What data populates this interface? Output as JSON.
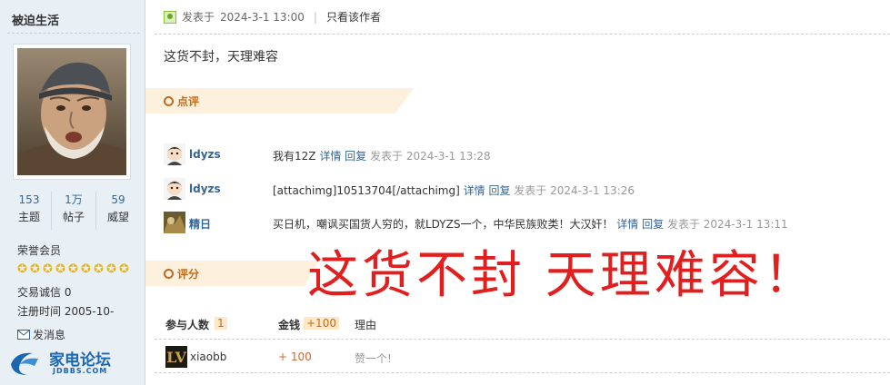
{
  "author": {
    "name": "被迫生活",
    "stats": [
      {
        "value": "153",
        "label": "主题"
      },
      {
        "value": "1万",
        "label": "帖子"
      },
      {
        "value": "59",
        "label": "威望"
      }
    ],
    "rank": "荣誉会员",
    "star_count": 9,
    "trade_label": "交易诚信",
    "trade_value": "0",
    "reg_label": "注册时间",
    "reg_value": "2005-10-",
    "pm_label": "发消息"
  },
  "forum_logo": {
    "name": "家电论坛",
    "domain": "JDBBS.COM"
  },
  "post": {
    "posted_label": "发表于",
    "posted_time": "2024-3-1 13:00",
    "separator": "|",
    "only_author": "只看该作者",
    "content": "这货不封，天理难容",
    "overlay_text": "这货不封  天理难容！"
  },
  "comments_section": {
    "title": "点评",
    "items": [
      {
        "user": "ldyzs",
        "text": "我有12Z",
        "detail": "详情",
        "reply": "回复",
        "time": "发表于 2024-3-1 13:28"
      },
      {
        "user": "ldyzs",
        "text": "[attachimg]10513704[/attachimg]",
        "detail": "详情",
        "reply": "回复",
        "time": "发表于 2024-3-1 13:26"
      },
      {
        "user": "精日",
        "text": "买日机，嘲讽买国货人穷的，就LDYZS一个，中华民族败类！大汉奸！",
        "detail": "详情",
        "reply": "回复",
        "time": "发表于 2024-3-1 13:11"
      }
    ]
  },
  "rating_section": {
    "title": "评分",
    "participants_label": "参与人数",
    "participants_count": "1",
    "money_label": "金钱",
    "money_total": "+100",
    "reason_label": "理由",
    "rows": [
      {
        "user": "xiaobb",
        "money": "+ 100",
        "reason": "赞一个!"
      }
    ]
  },
  "colors": {
    "link": "#336699",
    "section_title": "#c26b1c",
    "section_band": "#fdf1de",
    "overlay_red": "#e21f1f",
    "sidebar_bg": "#e8eff5",
    "star": "#f2b400"
  }
}
